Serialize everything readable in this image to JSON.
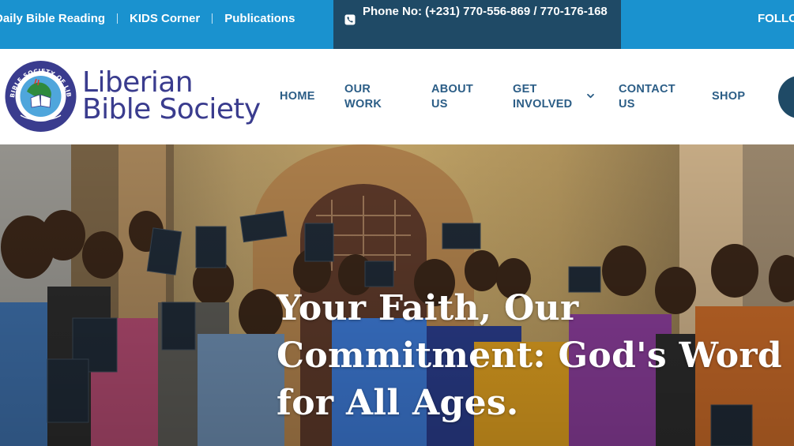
{
  "topbar": {
    "links": [
      "Daily Bible Reading",
      "KIDS Corner",
      "Publications"
    ],
    "phone_text": "Phone No: (+231) 770-556-869 / 770-176-168",
    "follow_text": "FOLLOW US"
  },
  "header": {
    "logo_ring_text": "BIBLE SOCIETY OF LIBERIA",
    "logo_line1": "Liberian",
    "logo_line2": "Bible Society",
    "nav": [
      {
        "label": "HOME"
      },
      {
        "label": "OUR WORK"
      },
      {
        "label": "ABOUT US"
      },
      {
        "label": "GET INVOLVED",
        "has_dropdown": true
      },
      {
        "label": "CONTACT US"
      },
      {
        "label": "SHOP"
      }
    ]
  },
  "hero": {
    "title": "Your Faith, Our Commitment: God's Word for All Ages."
  },
  "colors": {
    "topbar_blue": "#1a92cf",
    "phone_box": "#1f4a66",
    "nav_text": "#2b5d86",
    "logo_text": "#3a3c8e"
  },
  "icons": [
    "phone-icon",
    "chevron-down-icon",
    "search-icon",
    "bible-society-logo"
  ]
}
